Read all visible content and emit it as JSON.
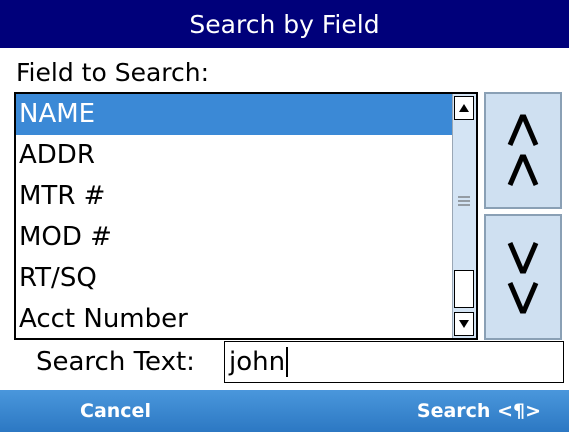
{
  "title": "Search by Field",
  "field_label": "Field to Search:",
  "fields": [
    {
      "label": "NAME",
      "selected": true
    },
    {
      "label": "ADDR",
      "selected": false
    },
    {
      "label": "MTR #",
      "selected": false
    },
    {
      "label": "MOD #",
      "selected": false
    },
    {
      "label": "RT/SQ",
      "selected": false
    },
    {
      "label": "Acct Number",
      "selected": false
    }
  ],
  "move_up_icon": "double-caret-up-icon",
  "move_down_icon": "double-caret-down-icon",
  "search_label": "Search Text:",
  "search_value": "john",
  "softkeys": {
    "left": "Cancel",
    "right": "Search <¶>"
  },
  "colors": {
    "title_bg": "#00007a",
    "selected_bg": "#3b89d6",
    "softkey_bg": "#2c78c3",
    "move_btn_bg": "#cfe0f1"
  }
}
